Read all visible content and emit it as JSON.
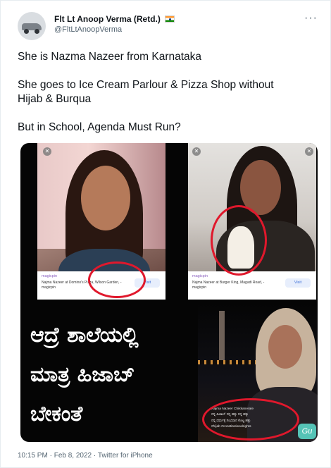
{
  "user": {
    "display_name": "Flt Lt Anoop Verma (Retd.)",
    "handle": "@FltLtAnoopVerma",
    "flag_icon": "india-flag-icon",
    "more_icon": "more-options-icon"
  },
  "tweet": {
    "paragraphs": [
      "She is Nazma Nazeer from Karnataka",
      "She goes to Ice Cream Parlour & Pizza Shop without\nHijab & Burqua",
      "But in School, Agenda Must Run?"
    ]
  },
  "media": {
    "card1": {
      "brand": "magicpin",
      "text": "Najma Nazeer at Domino's Pizza, Wilson Garden, - magicpin",
      "visit": "Visit"
    },
    "card2": {
      "brand": "magicpin",
      "text": "Najma Nazeer at Burger King, Magadi Road, - magicpin",
      "visit": "Visit"
    },
    "kannada_lines": [
      "ಆದ್ರೆ ಶಾಲೆಯಲ್ಲಿ",
      "ಮಾತ್ರ ಹಿಜಾಬ್",
      "ಬೇಕಂತೆ"
    ],
    "card3": {
      "title": "Najma Nazeer Chikkanerale",
      "line1": "ನನ್ನ ಹಿಜಾಬ್ ನನ್ನ ಹಕ್ಕು ನನ್ನ ಹಕ್ಕು",
      "line2": "ನನ್ನ ಧರ್ಮಕ್ಕೆ ಸಂವಿಧಾನ ಕೊಟ್ಟ ಹಕ್ಕು",
      "tags": "#hijab #constitutionalrights"
    },
    "badge_text": "Gu",
    "accent_red": "#e0182c"
  },
  "footer": {
    "time": "10:15 PM",
    "separator": "·",
    "date": "Feb 8, 2022",
    "source": "Twitter for iPhone"
  }
}
